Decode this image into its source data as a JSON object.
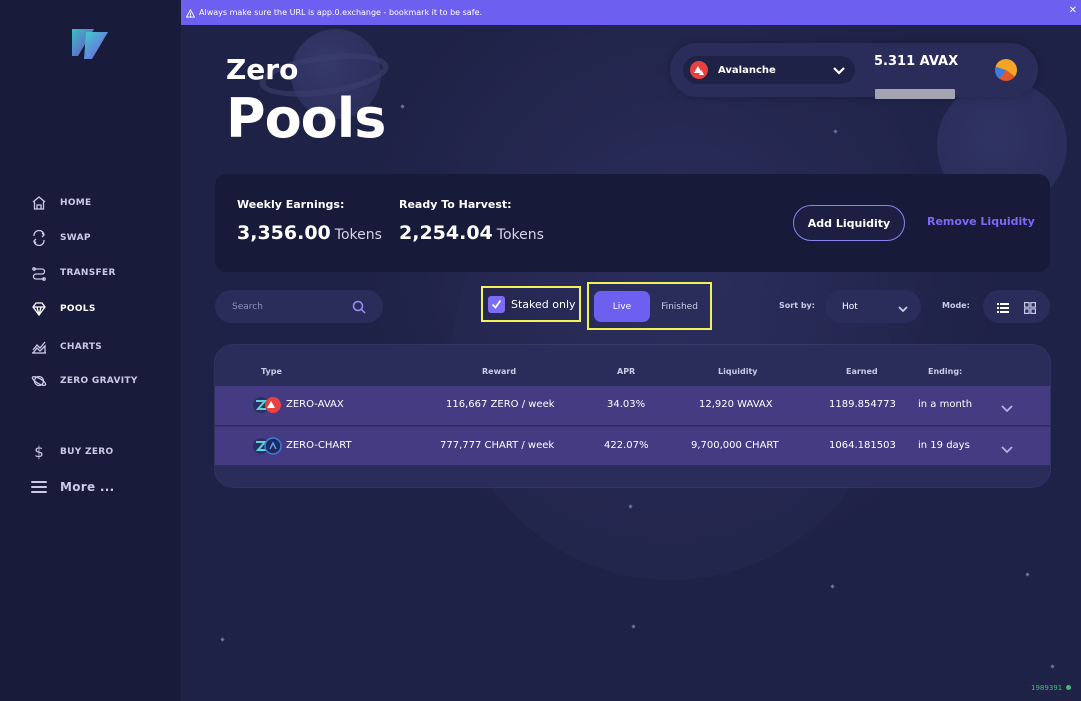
{
  "banner": {
    "text": "Always make sure the URL is app.0.exchange - bookmark it to be safe."
  },
  "sidebar": {
    "items": [
      {
        "label": "HOME",
        "icon": "home-icon"
      },
      {
        "label": "SWAP",
        "icon": "swap-icon"
      },
      {
        "label": "TRANSFER",
        "icon": "transfer-icon"
      },
      {
        "label": "POOLS",
        "icon": "diamond-icon"
      },
      {
        "label": "CHARTS",
        "icon": "chart-icon"
      },
      {
        "label": "ZERO GRAVITY",
        "icon": "planet-icon"
      }
    ],
    "buy": {
      "label": "BUY ZERO",
      "icon": "dollar-icon"
    },
    "more": {
      "label": "More ...",
      "icon": "menu-icon"
    }
  },
  "header": {
    "title_small": "Zero",
    "title_big": "Pools"
  },
  "wallet": {
    "network": "Avalanche",
    "balance": "5.311 AVAX"
  },
  "earnings": {
    "weekly_label": "Weekly Earnings:",
    "weekly_value": "3,356.00",
    "weekly_unit": "Tokens",
    "harvest_label": "Ready To Harvest:",
    "harvest_value": "2,254.04",
    "harvest_unit": "Tokens",
    "add_label": "Add Liquidity",
    "remove_label": "Remove Liquidity"
  },
  "filters": {
    "search_placeholder": "Search",
    "staked_label": "Staked only",
    "live_label": "Live",
    "finished_label": "Finished",
    "sort_label": "Sort by:",
    "sort_value": "Hot",
    "mode_label": "Mode:"
  },
  "table": {
    "headers": {
      "type": "Type",
      "reward": "Reward",
      "apr": "APR",
      "liquidity": "Liquidity",
      "earned": "Earned",
      "ending": "Ending:"
    },
    "rows": [
      {
        "type": "ZERO-AVAX",
        "reward": "116,667 ZERO / week",
        "apr": "34.03%",
        "liquidity": "12,920 WAVAX",
        "earned": "1189.854773",
        "ending": "in a month"
      },
      {
        "type": "ZERO-CHART",
        "reward": "777,777 CHART / week",
        "apr": "422.07%",
        "liquidity": "9,700,000 CHART",
        "earned": "1064.181503",
        "ending": "in 19 days"
      }
    ]
  },
  "footer": {
    "version": "1989391"
  },
  "colors": {
    "accent": "#6d5ff0",
    "highlight": "#f3f05a",
    "row": "#453b82",
    "avax": "#e84142"
  }
}
